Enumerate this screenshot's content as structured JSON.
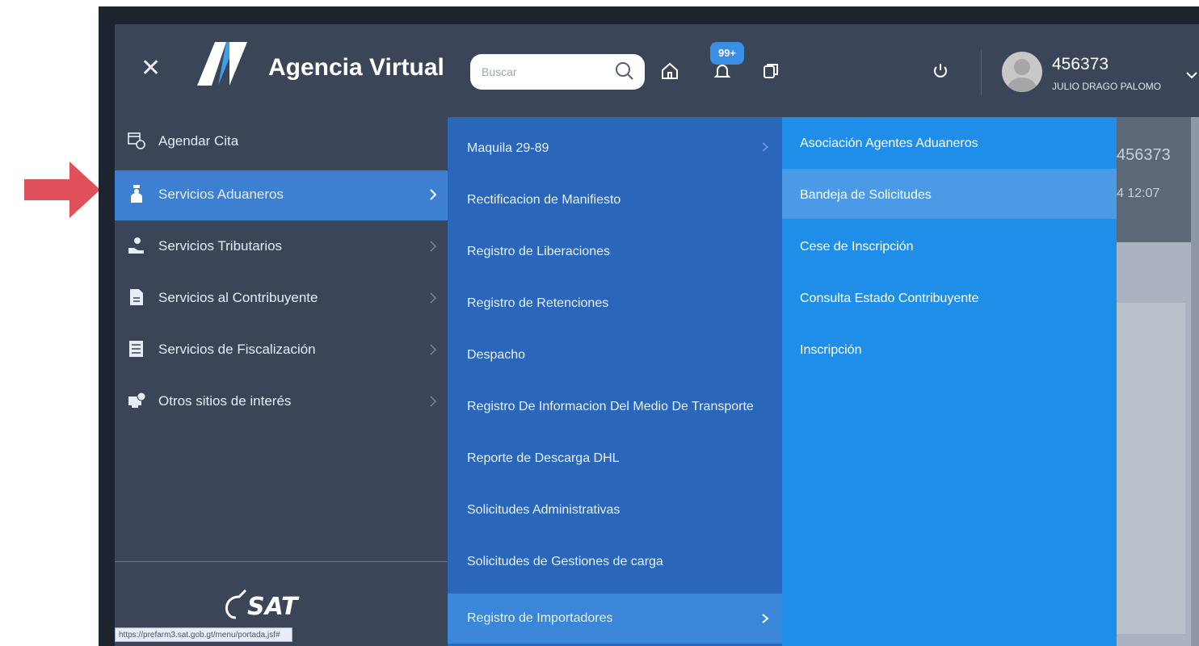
{
  "header": {
    "brand": "Agencia Virtual",
    "search_placeholder": "Buscar",
    "notification_count": "99+",
    "user_id": "456373",
    "user_name": "JULIO DRAGO PALOMO"
  },
  "sidebar": {
    "items": [
      {
        "label": "Agendar Cita",
        "icon": "calendar-clock-icon",
        "has_submenu": false,
        "active": false
      },
      {
        "label": "Servicios Aduaneros",
        "icon": "customs-officer-icon",
        "has_submenu": true,
        "active": true
      },
      {
        "label": "Servicios Tributarios",
        "icon": "hand-coins-icon",
        "has_submenu": true,
        "active": false
      },
      {
        "label": "Servicios al Contribuyente",
        "icon": "document-icon",
        "has_submenu": true,
        "active": false
      },
      {
        "label": "Servicios de Fiscalización",
        "icon": "checklist-icon",
        "has_submenu": true,
        "active": false
      },
      {
        "label": "Otros sitios de interés",
        "icon": "monitor-add-icon",
        "has_submenu": true,
        "active": false
      }
    ],
    "footer_logo": "SAT",
    "status_url": "https://prefarm3.sat.gob.gt/menu/portada.jsf#"
  },
  "submenu": {
    "items": [
      {
        "label": "Maquila 29-89",
        "has_submenu": true,
        "active": false
      },
      {
        "label": "Rectificacion de Manifiesto",
        "has_submenu": false,
        "active": false
      },
      {
        "label": "Registro de Liberaciones",
        "has_submenu": false,
        "active": false
      },
      {
        "label": "Registro de Retenciones",
        "has_submenu": false,
        "active": false
      },
      {
        "label": "Despacho",
        "has_submenu": false,
        "active": false
      },
      {
        "label": "Registro De Informacion Del Medio De Transporte",
        "has_submenu": false,
        "active": false
      },
      {
        "label": "Reporte de Descarga DHL",
        "has_submenu": false,
        "active": false
      },
      {
        "label": "Solicitudes Administrativas",
        "has_submenu": false,
        "active": false
      },
      {
        "label": "Solicitudes de Gestiones de carga",
        "has_submenu": false,
        "active": false
      },
      {
        "label": "Registro de Importadores",
        "has_submenu": true,
        "active": true
      }
    ]
  },
  "submenu2": {
    "items": [
      {
        "label": "Asociación Agentes Aduaneros",
        "active": false
      },
      {
        "label": "Bandeja de Solicitudes",
        "active": true
      },
      {
        "label": "Cese de Inscripción",
        "active": false
      },
      {
        "label": "Consulta Estado Contribuyente",
        "active": false
      },
      {
        "label": "Inscripción",
        "active": false
      }
    ]
  },
  "background_panel": {
    "id_fragment": "456373",
    "time_fragment": "4 12:07"
  },
  "colors": {
    "sidebar_bg": "#3a4558",
    "sidebar_active": "#3d7fd0",
    "submenu_bg": "#2a66ba",
    "submenu2_bg": "#1f8ee8",
    "badge": "#3a8ee6",
    "annotation_arrow": "#e0505a"
  }
}
